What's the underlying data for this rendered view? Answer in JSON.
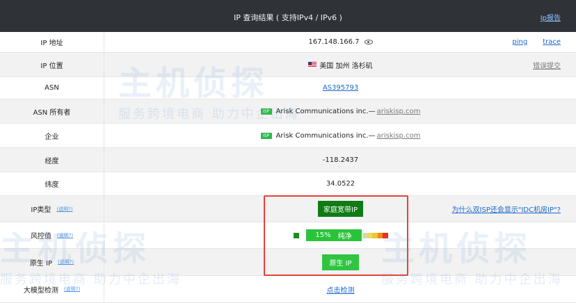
{
  "header": {
    "title": "IP 查询结果 ( 支持IPv4 / IPv6 )",
    "link": "Ip报告"
  },
  "rows": {
    "ip": {
      "label": "IP 地址",
      "value": "167.148.166.7",
      "ping": "ping",
      "trace": "trace"
    },
    "loc": {
      "label": "IP 位置",
      "value": "美国 加州 洛杉矶",
      "report": "错误提交"
    },
    "asn": {
      "label": "ASN",
      "value": "AS395793"
    },
    "asnowner": {
      "label": "ASN 所有者",
      "badge": "ISP",
      "name": "Arisk Communications inc.—",
      "site": "ariskisp.com"
    },
    "company": {
      "label": "企业",
      "badge": "ISP",
      "name": "Arisk Communications inc.—",
      "site": "ariskisp.com"
    },
    "lon": {
      "label": "经度",
      "value": "-118.2437"
    },
    "lat": {
      "label": "纬度",
      "value": "34.0522"
    },
    "iptype": {
      "label": "IP类型",
      "help": "(说明?)",
      "value": "家庭宽带IP",
      "link": "为什么双ISP还会显示\"IDC机房IP\"?"
    },
    "risk": {
      "label": "风控值",
      "help": "(说明?)",
      "percent": "15%",
      "text": "纯净",
      "level": 0.15
    },
    "native": {
      "label": "原生 IP",
      "help": "(说明?)",
      "value": "原生 IP"
    },
    "llm": {
      "label": "大模型检测",
      "help": "(说明?)",
      "link": "点击检测"
    }
  },
  "watermark": {
    "brand": "主机侦探",
    "slogan": "服务跨境电商 助力中企出海"
  },
  "colors": {
    "header_bg": "#2f3338",
    "accent_red": "#e2423a",
    "green_dark": "#0f7b14",
    "green": "#29c33a"
  }
}
